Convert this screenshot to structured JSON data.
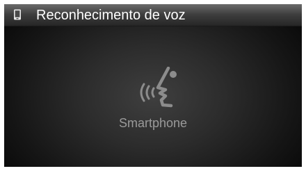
{
  "header": {
    "title": "Reconhecimento de voz",
    "icon": "phone-icon"
  },
  "main": {
    "icon": "voice-recognition-icon",
    "device_label": "Smartphone"
  },
  "colors": {
    "title_text": "#ffffff",
    "label_text": "#9a9a9a",
    "icon_gray": "#8c8c8c",
    "background": "#0e0e0e"
  }
}
